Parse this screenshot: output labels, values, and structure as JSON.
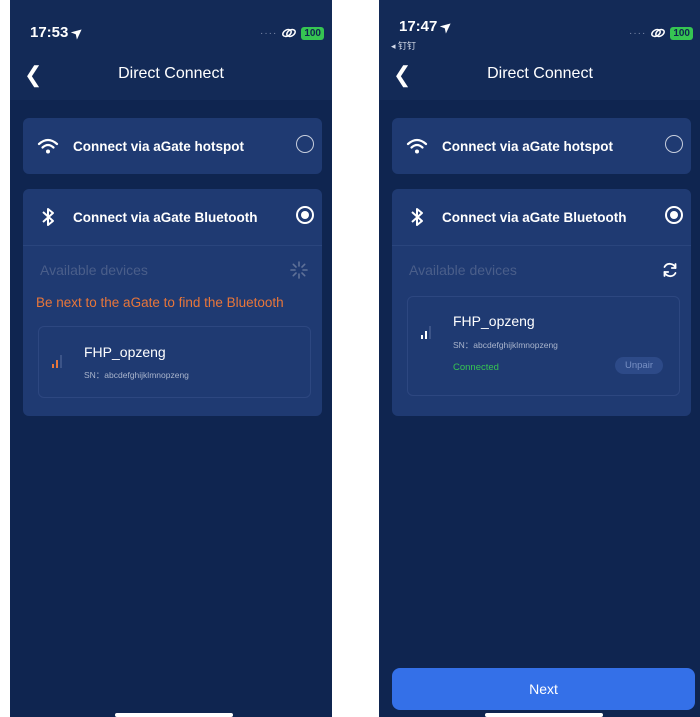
{
  "left": {
    "status": {
      "time": "17:53",
      "battery": "100"
    },
    "nav": {
      "title": "Direct Connect"
    },
    "hotspot": {
      "label": "Connect via aGate hotspot"
    },
    "bluetooth": {
      "label": "Connect via aGate Bluetooth"
    },
    "available_label": "Available devices",
    "warning": "Be next to the aGate to find the Bluetooth",
    "device": {
      "name": "FHP_opzeng",
      "sn": "SN：abcdefghijklmnopzeng"
    }
  },
  "right": {
    "status": {
      "time": "17:47",
      "sub_app": "◂ 钉钉",
      "battery": "100"
    },
    "nav": {
      "title": "Direct Connect"
    },
    "hotspot": {
      "label": "Connect via aGate hotspot"
    },
    "bluetooth": {
      "label": "Connect via aGate Bluetooth"
    },
    "available_label": "Available devices",
    "device": {
      "name": "FHP_opzeng",
      "sn": "SN：abcdefghijklmnopzeng",
      "status": "Connected",
      "unpair_label": "Unpair"
    },
    "next_label": "Next"
  },
  "icons": {
    "back": "back-chevron-icon",
    "wifi": "wifi-icon",
    "bluetooth": "bluetooth-icon",
    "spinner": "loading-spinner-icon",
    "refresh": "refresh-icon",
    "signal": "signal-strength-icon",
    "location": "location-arrow-icon",
    "link": "link-icon"
  },
  "colors": {
    "background": "#0f2550",
    "card": "#1f3a72",
    "warning": "#e8763a",
    "connected": "#36c552",
    "battery": "#36c552",
    "primary_button": "#3470e8"
  }
}
